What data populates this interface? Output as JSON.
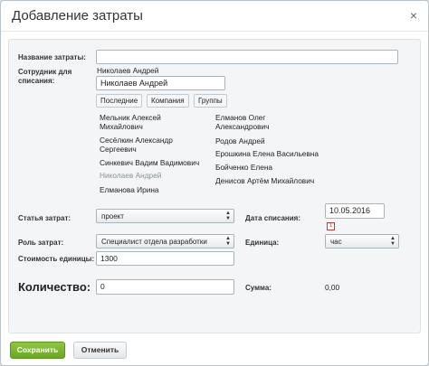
{
  "dialog": {
    "title": "Добавление затраты",
    "close_glyph": "×"
  },
  "form": {
    "name_label": "Название затраты:",
    "name_value": "",
    "employee_label": "Сотрудник для списания:",
    "employee_selected": "Николаев Андрей",
    "employee_input": "Николаев Андрей",
    "tabs": [
      "Последние",
      "Компания",
      "Группы"
    ],
    "employees_col1": [
      "Мельник Алексей Михайлович",
      "Сесёлкин Александр Сергеевич",
      "Синкевич Вадим Вадимович",
      "Николаев Андрей",
      "Елманова Ирина"
    ],
    "employees_col2": [
      "Елманов Олег Александрович",
      "Родов Андрей",
      "Ерошкина Елена Васильевна",
      "Бойченко Елена",
      "Денисов Артём Михайлович"
    ],
    "article_label": "Статья затрат:",
    "article_value": "проект",
    "date_label": "Дата списания:",
    "date_value": "10.05.2016",
    "calendar_icon_glyph": "1",
    "role_label": "Роль затрат:",
    "role_value": "Специалист отдела разработки",
    "unit_label": "Единица:",
    "unit_value": "час",
    "unit_cost_label": "Стоимость единицы:",
    "unit_cost_value": "1300",
    "quantity_label": "Количество:",
    "quantity_value": "0",
    "sum_label": "Сумма:",
    "sum_value": "0,00"
  },
  "buttons": {
    "save": "Сохранить",
    "cancel": "Отменить"
  }
}
